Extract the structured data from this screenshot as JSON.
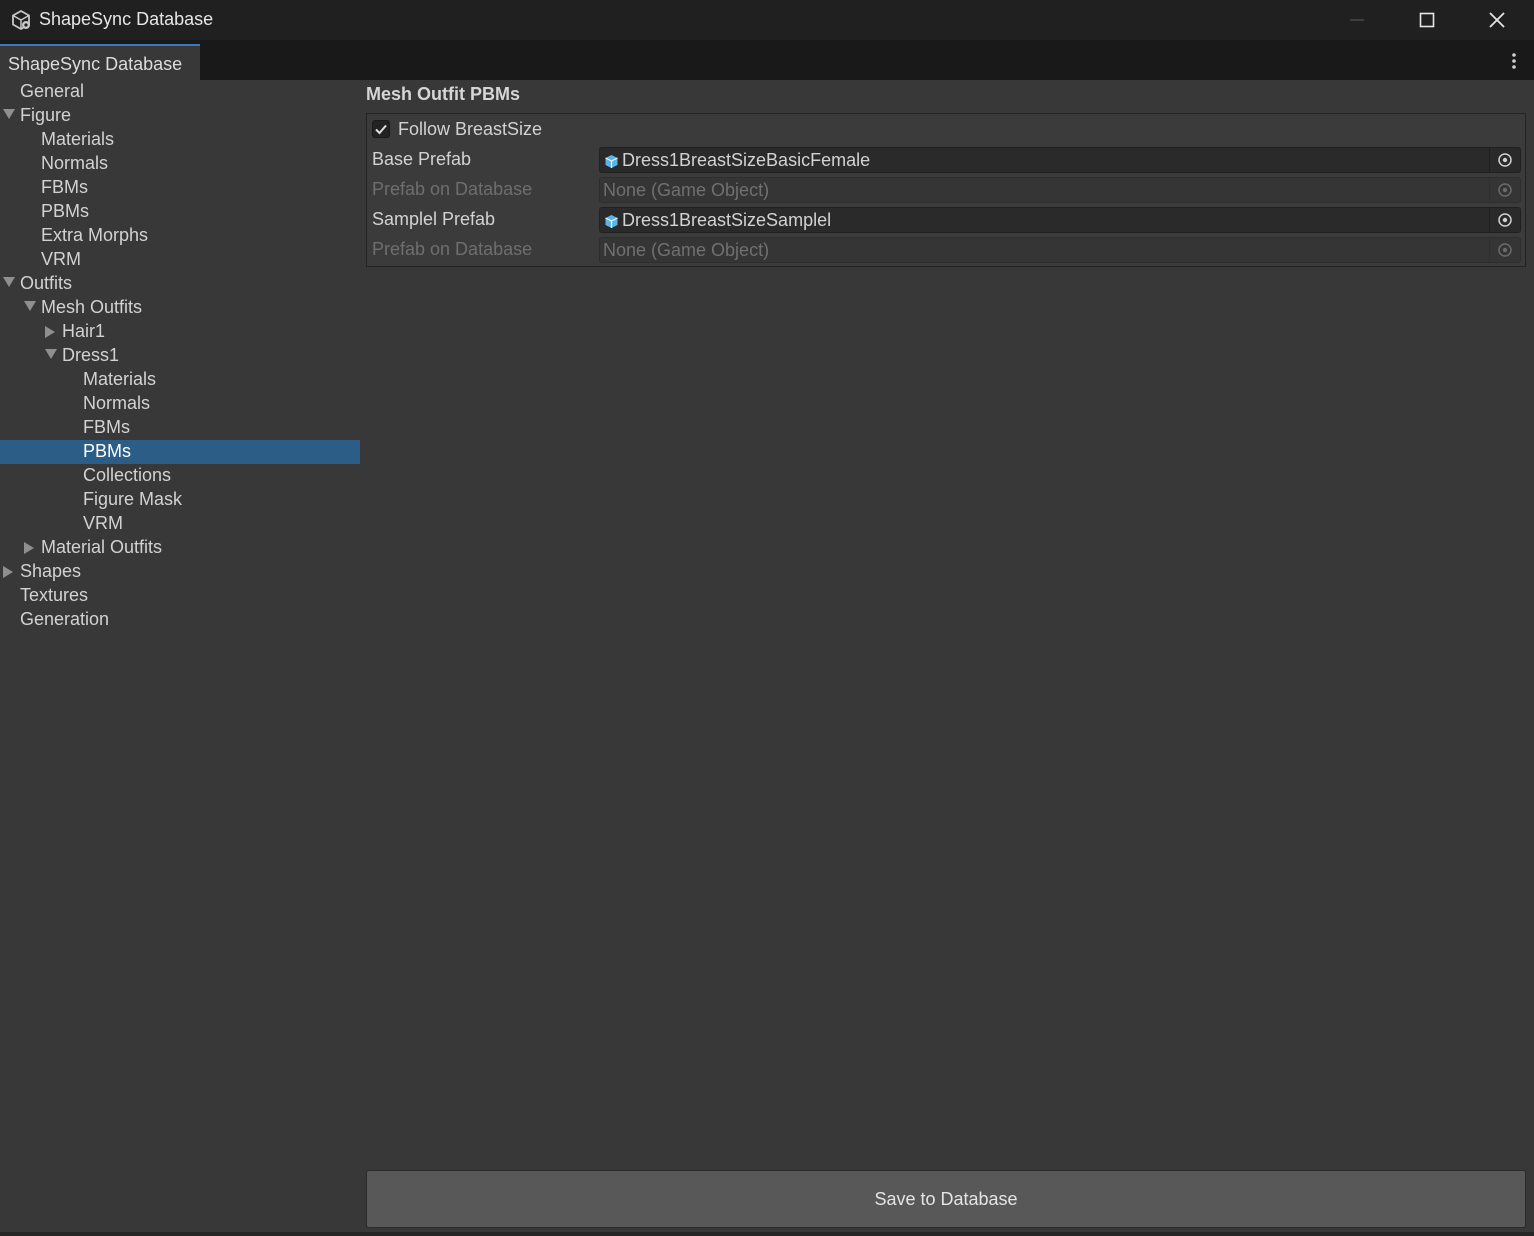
{
  "window": {
    "title": "ShapeSync Database",
    "minimize_glyph": "—",
    "maximize_glyph": "☐",
    "close_glyph": "✕"
  },
  "tabbar": {
    "tab_label": "ShapeSync Database",
    "menu_icon": "kebab-menu-icon"
  },
  "sidebar": {
    "items": [
      {
        "label": "General",
        "depth": 0,
        "arrow": "none",
        "selected": false
      },
      {
        "label": "Figure",
        "depth": 0,
        "arrow": "down",
        "selected": false
      },
      {
        "label": "Materials",
        "depth": 1,
        "arrow": "none",
        "selected": false
      },
      {
        "label": "Normals",
        "depth": 1,
        "arrow": "none",
        "selected": false
      },
      {
        "label": "FBMs",
        "depth": 1,
        "arrow": "none",
        "selected": false
      },
      {
        "label": "PBMs",
        "depth": 1,
        "arrow": "none",
        "selected": false
      },
      {
        "label": "Extra Morphs",
        "depth": 1,
        "arrow": "none",
        "selected": false
      },
      {
        "label": "VRM",
        "depth": 1,
        "arrow": "none",
        "selected": false
      },
      {
        "label": "Outfits",
        "depth": 0,
        "arrow": "down",
        "selected": false
      },
      {
        "label": "Mesh Outfits",
        "depth": 1,
        "arrow": "down",
        "selected": false
      },
      {
        "label": "Hair1",
        "depth": 2,
        "arrow": "right",
        "selected": false
      },
      {
        "label": "Dress1",
        "depth": 2,
        "arrow": "down",
        "selected": false
      },
      {
        "label": "Materials",
        "depth": 3,
        "arrow": "none",
        "selected": false
      },
      {
        "label": "Normals",
        "depth": 3,
        "arrow": "none",
        "selected": false
      },
      {
        "label": "FBMs",
        "depth": 3,
        "arrow": "none",
        "selected": false
      },
      {
        "label": "PBMs",
        "depth": 3,
        "arrow": "none",
        "selected": true
      },
      {
        "label": "Collections",
        "depth": 3,
        "arrow": "none",
        "selected": false
      },
      {
        "label": "Figure Mask",
        "depth": 3,
        "arrow": "none",
        "selected": false
      },
      {
        "label": "VRM",
        "depth": 3,
        "arrow": "none",
        "selected": false
      },
      {
        "label": "Material Outfits",
        "depth": 1,
        "arrow": "right",
        "selected": false
      },
      {
        "label": "Shapes",
        "depth": 0,
        "arrow": "right",
        "selected": false
      },
      {
        "label": "Textures",
        "depth": 0,
        "arrow": "none",
        "selected": false
      },
      {
        "label": "Generation",
        "depth": 0,
        "arrow": "none",
        "selected": false
      }
    ]
  },
  "main": {
    "section_title": "Mesh Outfit PBMs",
    "follow_checkbox": {
      "label": "Follow BreastSize",
      "checked": true
    },
    "fields": [
      {
        "label": "Base Prefab",
        "value": "Dress1BreastSizeBasicFemale",
        "enabled": true,
        "has_prefab_icon": true
      },
      {
        "label": "Prefab on Database",
        "value": "None (Game Object)",
        "enabled": false,
        "has_prefab_icon": false
      },
      {
        "label": "Samplel Prefab",
        "value": "Dress1BreastSizeSamplel",
        "enabled": true,
        "has_prefab_icon": true
      },
      {
        "label": "Prefab on Database",
        "value": "None (Game Object)",
        "enabled": false,
        "has_prefab_icon": false
      }
    ],
    "save_button_label": "Save to Database"
  },
  "colors": {
    "selection": "#2c5d87",
    "tab_accent": "#3a79bb",
    "background": "#383838",
    "prefab_icon": "#5ab4e6"
  }
}
